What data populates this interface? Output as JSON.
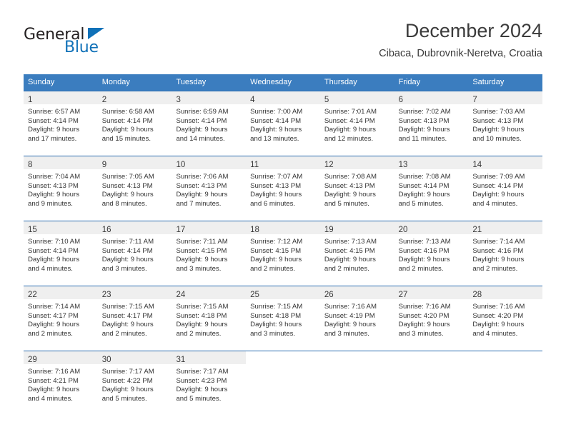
{
  "brand": {
    "name_part1": "General",
    "name_part2": "Blue",
    "flag_icon": "triangle-flag-icon",
    "accent_color": "#1071b8"
  },
  "header": {
    "title": "December 2024",
    "subtitle": "Cibaca, Dubrovnik-Neretva, Croatia"
  },
  "calendar": {
    "header_bg": "#3b7dbf",
    "row_divider": "#2a6cb0",
    "daynum_bg": "#efefef",
    "weekdays": [
      "Sunday",
      "Monday",
      "Tuesday",
      "Wednesday",
      "Thursday",
      "Friday",
      "Saturday"
    ],
    "weeks": [
      [
        {
          "day": "1",
          "sunrise": "Sunrise: 6:57 AM",
          "sunset": "Sunset: 4:14 PM",
          "daylight1": "Daylight: 9 hours",
          "daylight2": "and 17 minutes."
        },
        {
          "day": "2",
          "sunrise": "Sunrise: 6:58 AM",
          "sunset": "Sunset: 4:14 PM",
          "daylight1": "Daylight: 9 hours",
          "daylight2": "and 15 minutes."
        },
        {
          "day": "3",
          "sunrise": "Sunrise: 6:59 AM",
          "sunset": "Sunset: 4:14 PM",
          "daylight1": "Daylight: 9 hours",
          "daylight2": "and 14 minutes."
        },
        {
          "day": "4",
          "sunrise": "Sunrise: 7:00 AM",
          "sunset": "Sunset: 4:14 PM",
          "daylight1": "Daylight: 9 hours",
          "daylight2": "and 13 minutes."
        },
        {
          "day": "5",
          "sunrise": "Sunrise: 7:01 AM",
          "sunset": "Sunset: 4:14 PM",
          "daylight1": "Daylight: 9 hours",
          "daylight2": "and 12 minutes."
        },
        {
          "day": "6",
          "sunrise": "Sunrise: 7:02 AM",
          "sunset": "Sunset: 4:13 PM",
          "daylight1": "Daylight: 9 hours",
          "daylight2": "and 11 minutes."
        },
        {
          "day": "7",
          "sunrise": "Sunrise: 7:03 AM",
          "sunset": "Sunset: 4:13 PM",
          "daylight1": "Daylight: 9 hours",
          "daylight2": "and 10 minutes."
        }
      ],
      [
        {
          "day": "8",
          "sunrise": "Sunrise: 7:04 AM",
          "sunset": "Sunset: 4:13 PM",
          "daylight1": "Daylight: 9 hours",
          "daylight2": "and 9 minutes."
        },
        {
          "day": "9",
          "sunrise": "Sunrise: 7:05 AM",
          "sunset": "Sunset: 4:13 PM",
          "daylight1": "Daylight: 9 hours",
          "daylight2": "and 8 minutes."
        },
        {
          "day": "10",
          "sunrise": "Sunrise: 7:06 AM",
          "sunset": "Sunset: 4:13 PM",
          "daylight1": "Daylight: 9 hours",
          "daylight2": "and 7 minutes."
        },
        {
          "day": "11",
          "sunrise": "Sunrise: 7:07 AM",
          "sunset": "Sunset: 4:13 PM",
          "daylight1": "Daylight: 9 hours",
          "daylight2": "and 6 minutes."
        },
        {
          "day": "12",
          "sunrise": "Sunrise: 7:08 AM",
          "sunset": "Sunset: 4:13 PM",
          "daylight1": "Daylight: 9 hours",
          "daylight2": "and 5 minutes."
        },
        {
          "day": "13",
          "sunrise": "Sunrise: 7:08 AM",
          "sunset": "Sunset: 4:14 PM",
          "daylight1": "Daylight: 9 hours",
          "daylight2": "and 5 minutes."
        },
        {
          "day": "14",
          "sunrise": "Sunrise: 7:09 AM",
          "sunset": "Sunset: 4:14 PM",
          "daylight1": "Daylight: 9 hours",
          "daylight2": "and 4 minutes."
        }
      ],
      [
        {
          "day": "15",
          "sunrise": "Sunrise: 7:10 AM",
          "sunset": "Sunset: 4:14 PM",
          "daylight1": "Daylight: 9 hours",
          "daylight2": "and 4 minutes."
        },
        {
          "day": "16",
          "sunrise": "Sunrise: 7:11 AM",
          "sunset": "Sunset: 4:14 PM",
          "daylight1": "Daylight: 9 hours",
          "daylight2": "and 3 minutes."
        },
        {
          "day": "17",
          "sunrise": "Sunrise: 7:11 AM",
          "sunset": "Sunset: 4:15 PM",
          "daylight1": "Daylight: 9 hours",
          "daylight2": "and 3 minutes."
        },
        {
          "day": "18",
          "sunrise": "Sunrise: 7:12 AM",
          "sunset": "Sunset: 4:15 PM",
          "daylight1": "Daylight: 9 hours",
          "daylight2": "and 2 minutes."
        },
        {
          "day": "19",
          "sunrise": "Sunrise: 7:13 AM",
          "sunset": "Sunset: 4:15 PM",
          "daylight1": "Daylight: 9 hours",
          "daylight2": "and 2 minutes."
        },
        {
          "day": "20",
          "sunrise": "Sunrise: 7:13 AM",
          "sunset": "Sunset: 4:16 PM",
          "daylight1": "Daylight: 9 hours",
          "daylight2": "and 2 minutes."
        },
        {
          "day": "21",
          "sunrise": "Sunrise: 7:14 AM",
          "sunset": "Sunset: 4:16 PM",
          "daylight1": "Daylight: 9 hours",
          "daylight2": "and 2 minutes."
        }
      ],
      [
        {
          "day": "22",
          "sunrise": "Sunrise: 7:14 AM",
          "sunset": "Sunset: 4:17 PM",
          "daylight1": "Daylight: 9 hours",
          "daylight2": "and 2 minutes."
        },
        {
          "day": "23",
          "sunrise": "Sunrise: 7:15 AM",
          "sunset": "Sunset: 4:17 PM",
          "daylight1": "Daylight: 9 hours",
          "daylight2": "and 2 minutes."
        },
        {
          "day": "24",
          "sunrise": "Sunrise: 7:15 AM",
          "sunset": "Sunset: 4:18 PM",
          "daylight1": "Daylight: 9 hours",
          "daylight2": "and 2 minutes."
        },
        {
          "day": "25",
          "sunrise": "Sunrise: 7:15 AM",
          "sunset": "Sunset: 4:18 PM",
          "daylight1": "Daylight: 9 hours",
          "daylight2": "and 3 minutes."
        },
        {
          "day": "26",
          "sunrise": "Sunrise: 7:16 AM",
          "sunset": "Sunset: 4:19 PM",
          "daylight1": "Daylight: 9 hours",
          "daylight2": "and 3 minutes."
        },
        {
          "day": "27",
          "sunrise": "Sunrise: 7:16 AM",
          "sunset": "Sunset: 4:20 PM",
          "daylight1": "Daylight: 9 hours",
          "daylight2": "and 3 minutes."
        },
        {
          "day": "28",
          "sunrise": "Sunrise: 7:16 AM",
          "sunset": "Sunset: 4:20 PM",
          "daylight1": "Daylight: 9 hours",
          "daylight2": "and 4 minutes."
        }
      ],
      [
        {
          "day": "29",
          "sunrise": "Sunrise: 7:16 AM",
          "sunset": "Sunset: 4:21 PM",
          "daylight1": "Daylight: 9 hours",
          "daylight2": "and 4 minutes."
        },
        {
          "day": "30",
          "sunrise": "Sunrise: 7:17 AM",
          "sunset": "Sunset: 4:22 PM",
          "daylight1": "Daylight: 9 hours",
          "daylight2": "and 5 minutes."
        },
        {
          "day": "31",
          "sunrise": "Sunrise: 7:17 AM",
          "sunset": "Sunset: 4:23 PM",
          "daylight1": "Daylight: 9 hours",
          "daylight2": "and 5 minutes."
        },
        {
          "day": "",
          "sunrise": "",
          "sunset": "",
          "daylight1": "",
          "daylight2": ""
        },
        {
          "day": "",
          "sunrise": "",
          "sunset": "",
          "daylight1": "",
          "daylight2": ""
        },
        {
          "day": "",
          "sunrise": "",
          "sunset": "",
          "daylight1": "",
          "daylight2": ""
        },
        {
          "day": "",
          "sunrise": "",
          "sunset": "",
          "daylight1": "",
          "daylight2": ""
        }
      ]
    ]
  }
}
